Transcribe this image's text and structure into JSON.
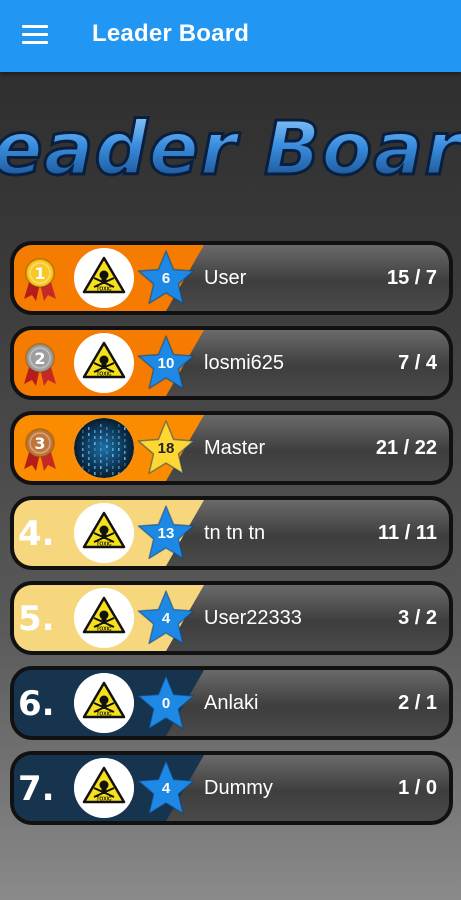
{
  "appbar": {
    "title": "Leader Board",
    "menu_icon": "hamburger-menu-icon"
  },
  "banner": {
    "text": "Leader Board"
  },
  "colors": {
    "appbar": "#2196f3",
    "orange": "#f57c00",
    "light_orange": "#fb8c00",
    "cream": "#f6d77e",
    "navy": "#17344f",
    "star_blue": "#1e88e5",
    "star_yellow": "#fdd835",
    "gold": "#f9c825",
    "silver": "#9e9e9e",
    "bronze": "#c0763a"
  },
  "players": [
    {
      "rank": "1",
      "rank_style": "medal",
      "medal": "gold",
      "strip": "#f57c00",
      "avatar": "toxic",
      "avatar_label": "TOXIC",
      "level": "6",
      "star": "blue",
      "name": "User",
      "score": "15 / 7"
    },
    {
      "rank": "2",
      "rank_style": "medal",
      "medal": "silver",
      "strip": "#f57c00",
      "avatar": "toxic",
      "avatar_label": "TOXIC",
      "level": "10",
      "star": "blue",
      "name": "losmi625",
      "score": "7 / 4"
    },
    {
      "rank": "3",
      "rank_style": "medal",
      "medal": "bronze",
      "strip": "#fb8c00",
      "avatar": "matrix",
      "avatar_label": "",
      "level": "18",
      "star": "yellow",
      "name": "Master",
      "score": "21 / 22"
    },
    {
      "rank": "4.",
      "rank_style": "number",
      "medal": "",
      "strip": "#f6d77e",
      "avatar": "toxic",
      "avatar_label": "TOXIC",
      "level": "13",
      "star": "blue",
      "name": "tn tn tn",
      "score": "11 / 11"
    },
    {
      "rank": "5.",
      "rank_style": "number",
      "medal": "",
      "strip": "#f6d77e",
      "avatar": "toxic",
      "avatar_label": "TOXIC",
      "level": "4",
      "star": "blue",
      "name": "User22333",
      "score": "3 / 2"
    },
    {
      "rank": "6.",
      "rank_style": "number",
      "medal": "",
      "strip": "#17344f",
      "avatar": "toxic",
      "avatar_label": "TOXIC",
      "level": "0",
      "star": "blue",
      "name": "Anlaki",
      "score": "2 / 1"
    },
    {
      "rank": "7.",
      "rank_style": "number",
      "medal": "",
      "strip": "#17344f",
      "avatar": "toxic",
      "avatar_label": "TOXIC",
      "level": "4",
      "star": "blue",
      "name": "Dummy",
      "score": "1 / 0"
    }
  ]
}
